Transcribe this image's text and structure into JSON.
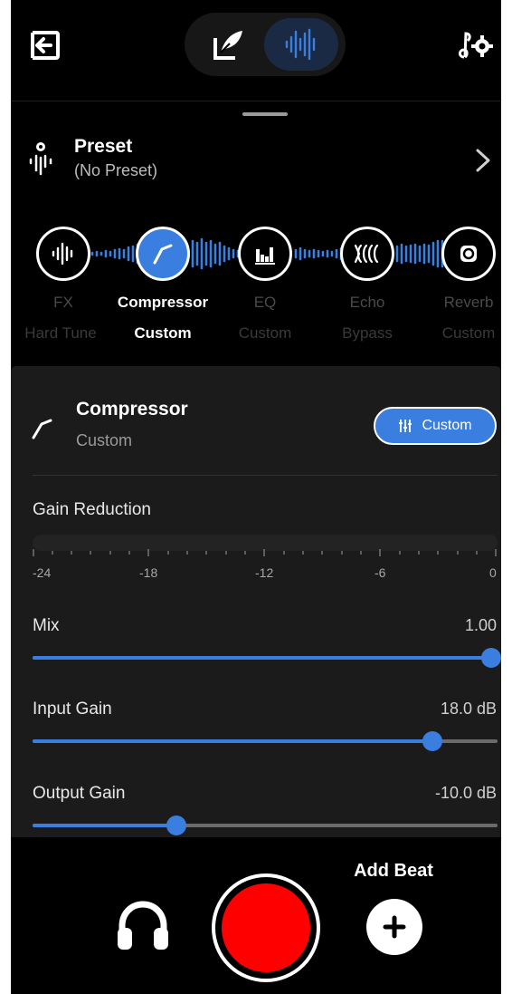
{
  "topbar": {
    "exit_icon": "exit-icon",
    "settings_icon": "music-settings-icon",
    "modes": [
      {
        "name": "lyrics",
        "icon": "quill-pen-icon",
        "active": false
      },
      {
        "name": "record",
        "icon": "waveform-icon",
        "active": true
      }
    ]
  },
  "preset": {
    "title": "Preset",
    "subtitle": "(No Preset)",
    "icon": "preset-icon"
  },
  "chain": [
    {
      "label": "FX",
      "value": "Hard Tune",
      "icon": "waveform-icon",
      "active": false
    },
    {
      "label": "Compressor",
      "value": "Custom",
      "icon": "compressor-curve-icon",
      "active": true
    },
    {
      "label": "EQ",
      "value": "Custom",
      "icon": "equalizer-bars-icon",
      "active": false
    },
    {
      "label": "Echo",
      "value": "Bypass",
      "icon": "echo-icon",
      "active": false
    },
    {
      "label": "Reverb",
      "value": "Custom",
      "icon": "reverb-icon",
      "active": false
    }
  ],
  "panel": {
    "title": "Compressor",
    "subtitle": "Custom",
    "custom_button": "Custom",
    "gain_reduction": {
      "label": "Gain Reduction",
      "ticks": [
        "-24",
        "-18",
        "-12",
        "-6",
        "0"
      ],
      "level": 0
    },
    "sliders": [
      {
        "label": "Mix",
        "value": "1.00",
        "fraction": 1.0
      },
      {
        "label": "Input Gain",
        "value": "18.0 dB",
        "fraction": 0.86
      },
      {
        "label": "Output Gain",
        "value": "-10.0 dB",
        "fraction": 0.31
      }
    ]
  },
  "bottom": {
    "add_beat_label": "Add Beat",
    "headphones_icon": "headphones-icon",
    "record_color": "#ff0000",
    "add_icon": "plus-icon"
  },
  "colors": {
    "accent": "#3a7ee0",
    "background": "#000000",
    "panel": "#1b1b1b"
  }
}
